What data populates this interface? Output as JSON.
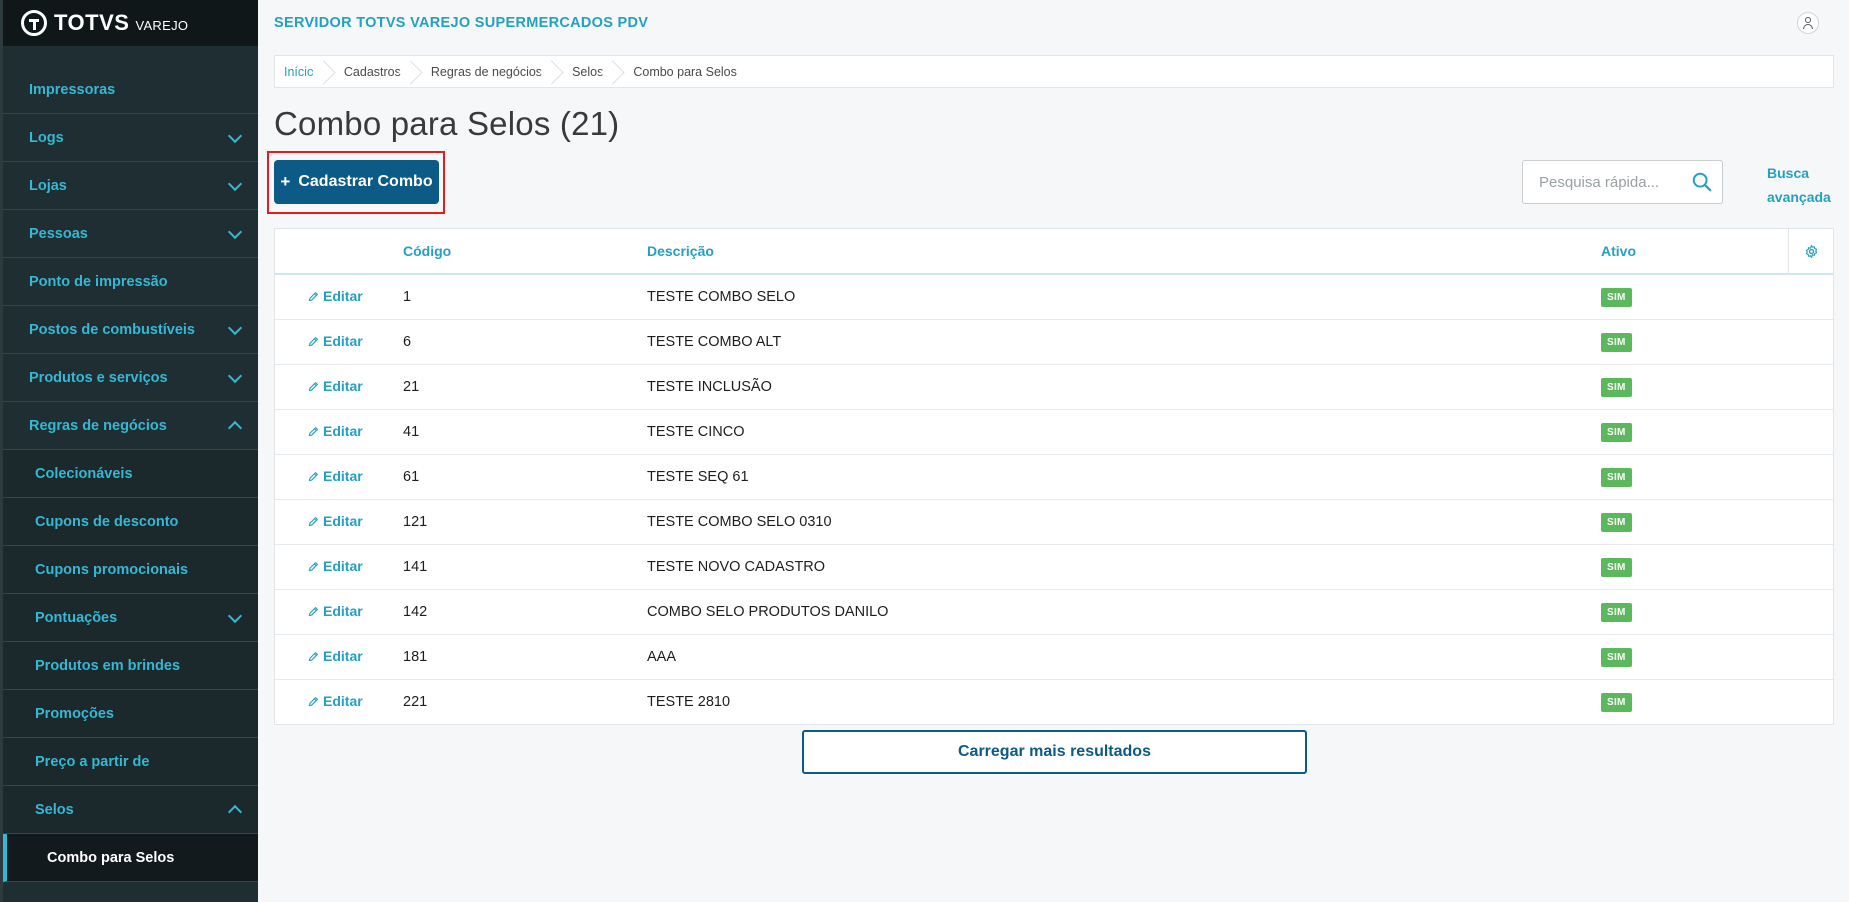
{
  "logo": {
    "name": "TOTVS",
    "sub": "VAREJO"
  },
  "header": {
    "title": "SERVIDOR TOTVS VAREJO SUPERMERCADOS PDV"
  },
  "sidebar": {
    "items": [
      {
        "label": "Impressoras",
        "chevron": "none"
      },
      {
        "label": "Logs",
        "chevron": "down"
      },
      {
        "label": "Lojas",
        "chevron": "down"
      },
      {
        "label": "Pessoas",
        "chevron": "down"
      },
      {
        "label": "Ponto de impressão",
        "chevron": "none"
      },
      {
        "label": "Postos de combustíveis",
        "chevron": "down"
      },
      {
        "label": "Produtos e serviços",
        "chevron": "down"
      },
      {
        "label": "Regras de negócios",
        "chevron": "up"
      },
      {
        "label": "Colecionáveis",
        "chevron": "none",
        "level": 1
      },
      {
        "label": "Cupons de desconto",
        "chevron": "none",
        "level": 1
      },
      {
        "label": "Cupons promocionais",
        "chevron": "none",
        "level": 1
      },
      {
        "label": "Pontuações",
        "chevron": "down",
        "level": 1
      },
      {
        "label": "Produtos em brindes",
        "chevron": "none",
        "level": 1
      },
      {
        "label": "Promoções",
        "chevron": "none",
        "level": 1
      },
      {
        "label": "Preço a partir de",
        "chevron": "none",
        "level": 1
      },
      {
        "label": "Selos",
        "chevron": "up",
        "level": 1
      },
      {
        "label": "Combo para Selos",
        "chevron": "none",
        "level": 2,
        "active": true
      }
    ]
  },
  "breadcrumb": [
    {
      "label": "Início",
      "link": true
    },
    {
      "label": "Cadastros",
      "link": false
    },
    {
      "label": "Regras de negócios",
      "link": false
    },
    {
      "label": "Selos",
      "link": false
    },
    {
      "label": "Combo para Selos",
      "link": false
    }
  ],
  "page": {
    "title": "Combo para Selos (21)"
  },
  "toolbar": {
    "add_plus": "+",
    "add_label": "Cadastrar Combo",
    "search_placeholder": "Pesquisa rápida...",
    "advanced_search": "Busca avançada"
  },
  "table": {
    "columns": {
      "code": "Código",
      "description": "Descrição",
      "active": "Ativo"
    },
    "edit_label": "Editar",
    "rows": [
      {
        "code": "1",
        "description": "TESTE COMBO SELO",
        "active": "SIM"
      },
      {
        "code": "6",
        "description": "TESTE COMBO ALT",
        "active": "SIM"
      },
      {
        "code": "21",
        "description": "TESTE INCLUSÃO",
        "active": "SIM"
      },
      {
        "code": "41",
        "description": "TESTE CINCO",
        "active": "SIM"
      },
      {
        "code": "61",
        "description": "TESTE SEQ 61",
        "active": "SIM"
      },
      {
        "code": "121",
        "description": "TESTE COMBO SELO 0310",
        "active": "SIM"
      },
      {
        "code": "141",
        "description": "TESTE NOVO CADASTRO",
        "active": "SIM"
      },
      {
        "code": "142",
        "description": "COMBO SELO PRODUTOS DANILO",
        "active": "SIM"
      },
      {
        "code": "181",
        "description": "AAA",
        "active": "SIM"
      },
      {
        "code": "221",
        "description": "TESTE 2810",
        "active": "SIM"
      }
    ]
  },
  "load_more": {
    "label": "Carregar mais resultados"
  },
  "colors": {
    "accent": "#23a0c2",
    "primary": "#0c5a86",
    "sidebar_bg": "#1f2e33",
    "badge_green": "#5cb85c",
    "highlight_red": "#e81a1a"
  }
}
